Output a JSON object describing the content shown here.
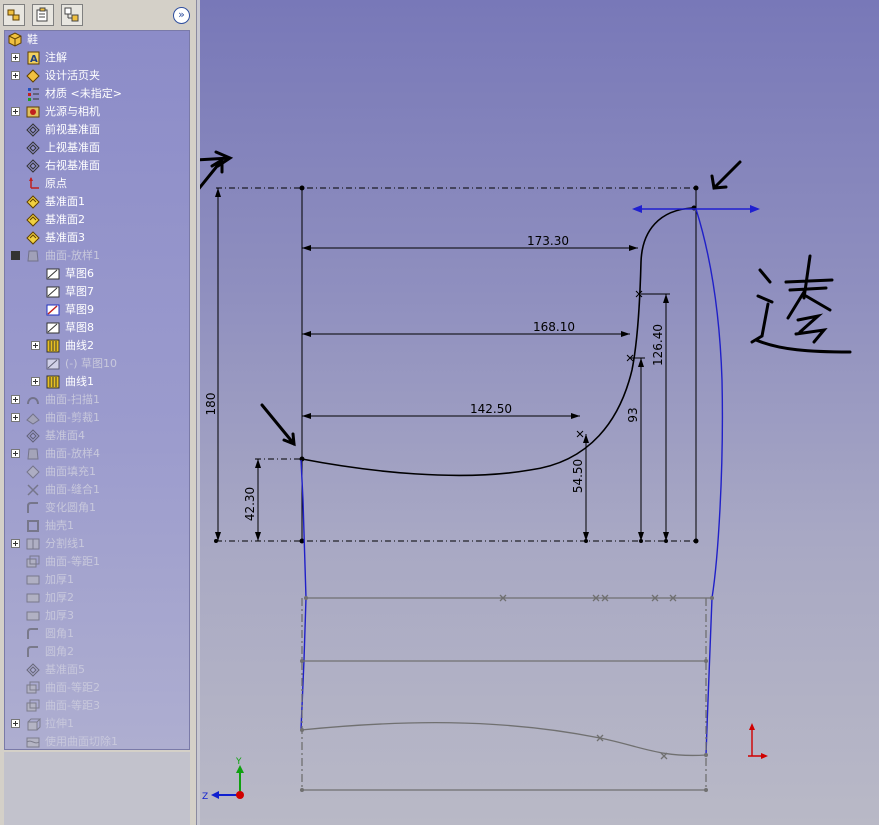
{
  "panel": {
    "root_label": "鞋",
    "items": [
      {
        "label": "注解",
        "icon": "annotations-icon",
        "expander": "plus",
        "indent": 0,
        "dim": false
      },
      {
        "label": "设计活页夹",
        "icon": "design-binder-icon",
        "expander": "plus",
        "indent": 0,
        "dim": false
      },
      {
        "label": "材质 <未指定>",
        "icon": "material-icon",
        "expander": "none",
        "indent": 0,
        "dim": false
      },
      {
        "label": "光源与相机",
        "icon": "lights-cameras-icon",
        "expander": "plus",
        "indent": 0,
        "dim": false
      },
      {
        "label": "前视基准面",
        "icon": "plane-icon",
        "expander": "none",
        "indent": 0,
        "dim": false
      },
      {
        "label": "上视基准面",
        "icon": "plane-icon",
        "expander": "none",
        "indent": 0,
        "dim": false
      },
      {
        "label": "右视基准面",
        "icon": "plane-icon",
        "expander": "none",
        "indent": 0,
        "dim": false
      },
      {
        "label": "原点",
        "icon": "origin-icon",
        "expander": "none",
        "indent": 0,
        "dim": false
      },
      {
        "label": "基准面1",
        "icon": "plane-yellow-icon",
        "expander": "none",
        "indent": 0,
        "dim": false
      },
      {
        "label": "基准面2",
        "icon": "plane-yellow-icon",
        "expander": "none",
        "indent": 0,
        "dim": false
      },
      {
        "label": "基准面3",
        "icon": "plane-yellow-icon",
        "expander": "none",
        "indent": 0,
        "dim": false
      },
      {
        "label": "曲面-放样1",
        "icon": "surface-loft-icon",
        "expander": "minus",
        "indent": 0,
        "dim": true
      },
      {
        "label": "草图6",
        "icon": "sketch-icon",
        "expander": "none",
        "indent": 1,
        "dim": false
      },
      {
        "label": "草图7",
        "icon": "sketch-icon",
        "expander": "none",
        "indent": 1,
        "dim": false
      },
      {
        "label": "草图9",
        "icon": "sketch-active-icon",
        "expander": "none",
        "indent": 1,
        "dim": false
      },
      {
        "label": "草图8",
        "icon": "sketch-icon",
        "expander": "none",
        "indent": 1,
        "dim": false
      },
      {
        "label": "曲线2",
        "icon": "curve-icon",
        "expander": "plus",
        "indent": 1,
        "dim": false
      },
      {
        "label": "(-) 草图10",
        "icon": "sketch-icon",
        "expander": "none",
        "indent": 1,
        "dim": true
      },
      {
        "label": "曲线1",
        "icon": "curve-icon",
        "expander": "plus",
        "indent": 1,
        "dim": false
      },
      {
        "label": "曲面-扫描1",
        "icon": "surface-sweep-icon",
        "expander": "plus",
        "indent": 0,
        "dim": true
      },
      {
        "label": "曲面-剪裁1",
        "icon": "surface-trim-icon",
        "expander": "plus",
        "indent": 0,
        "dim": true
      },
      {
        "label": "基准面4",
        "icon": "plane-icon",
        "expander": "none",
        "indent": 0,
        "dim": true
      },
      {
        "label": "曲面-放样4",
        "icon": "surface-loft-icon",
        "expander": "plus",
        "indent": 0,
        "dim": true
      },
      {
        "label": "曲面填充1",
        "icon": "surface-fill-icon",
        "expander": "none",
        "indent": 0,
        "dim": true
      },
      {
        "label": "曲面-缝合1",
        "icon": "surface-knit-icon",
        "expander": "none",
        "indent": 0,
        "dim": true
      },
      {
        "label": "变化圆角1",
        "icon": "fillet-icon",
        "expander": "none",
        "indent": 0,
        "dim": true
      },
      {
        "label": "抽壳1",
        "icon": "shell-icon",
        "expander": "none",
        "indent": 0,
        "dim": true
      },
      {
        "label": "分割线1",
        "icon": "split-line-icon",
        "expander": "plus",
        "indent": 0,
        "dim": true
      },
      {
        "label": "曲面-等距1",
        "icon": "surface-offset-icon",
        "expander": "none",
        "indent": 0,
        "dim": true
      },
      {
        "label": "加厚1",
        "icon": "thicken-icon",
        "expander": "none",
        "indent": 0,
        "dim": true
      },
      {
        "label": "加厚2",
        "icon": "thicken-icon",
        "expander": "none",
        "indent": 0,
        "dim": true
      },
      {
        "label": "加厚3",
        "icon": "thicken-icon",
        "expander": "none",
        "indent": 0,
        "dim": true
      },
      {
        "label": "圆角1",
        "icon": "fillet-icon",
        "expander": "none",
        "indent": 0,
        "dim": true
      },
      {
        "label": "圆角2",
        "icon": "fillet-icon",
        "expander": "none",
        "indent": 0,
        "dim": true
      },
      {
        "label": "基准面5",
        "icon": "plane-icon",
        "expander": "none",
        "indent": 0,
        "dim": true
      },
      {
        "label": "曲面-等距2",
        "icon": "surface-offset-icon",
        "expander": "none",
        "indent": 0,
        "dim": true
      },
      {
        "label": "曲面-等距3",
        "icon": "surface-offset-icon",
        "expander": "none",
        "indent": 0,
        "dim": true
      },
      {
        "label": "拉伸1",
        "icon": "extrude-icon",
        "expander": "plus",
        "indent": 0,
        "dim": true
      },
      {
        "label": "使用曲面切除1",
        "icon": "surface-cut-icon",
        "expander": "none",
        "indent": 0,
        "dim": true
      }
    ]
  },
  "sketch": {
    "dimensions": [
      "173.30",
      "168.10",
      "142.50",
      "126.40",
      "93",
      "54.50",
      "180",
      "42.30"
    ],
    "handwritten": "透"
  },
  "triad": {
    "y_label": "Y",
    "z_label": "Z"
  }
}
